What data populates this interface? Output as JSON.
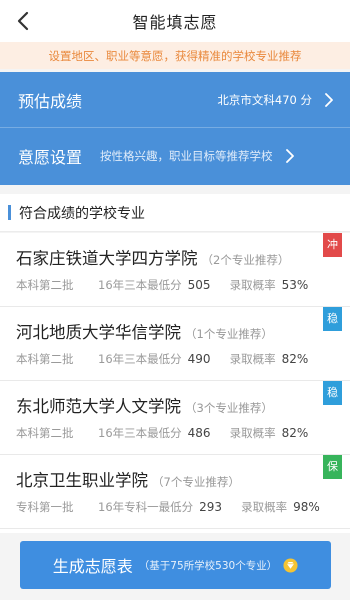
{
  "header": {
    "title": "智能填志愿",
    "back_icon": "back-arrow-icon"
  },
  "tip": {
    "text": "设置地区、职业等意愿，获得精准的学校专业推荐",
    "color": "#e9893d"
  },
  "settings": {
    "score_label": "预估成绩",
    "score_value": "北京市文科470 分",
    "preference_label": "意愿设置",
    "preference_hint": "按性格兴趣，职业目标等推荐学校"
  },
  "section": {
    "title": "符合成绩的学校专业"
  },
  "schools": [
    {
      "name": "石家庄铁道大学四方学院",
      "count": "（2个专业推荐）",
      "batch": "本科第二批",
      "score_label": "16年三本最低分",
      "score": "505",
      "prob_label": "录取概率",
      "prob": "53%",
      "tag": "冲",
      "tag_color": "#e24a4a"
    },
    {
      "name": "河北地质大学华信学院",
      "count": "（1个专业推荐）",
      "batch": "本科第二批",
      "score_label": "16年三本最低分",
      "score": "490",
      "prob_label": "录取概率",
      "prob": "82%",
      "tag": "稳",
      "tag_color": "#2f9edb"
    },
    {
      "name": "东北师范大学人文学院",
      "count": "（3个专业推荐）",
      "batch": "本科第二批",
      "score_label": "16年三本最低分",
      "score": "486",
      "prob_label": "录取概率",
      "prob": "82%",
      "tag": "稳",
      "tag_color": "#2f9edb"
    },
    {
      "name": "北京卫生职业学院",
      "count": "（7个专业推荐）",
      "batch": "专科第一批",
      "score_label": "16年专科一最低分",
      "score": "293",
      "prob_label": "录取概率",
      "prob": "98%",
      "tag": "保",
      "tag_color": "#37b45b"
    }
  ],
  "generate": {
    "label": "生成志愿表",
    "sub": "（基于75所学校530个专业）",
    "icon": "vip-diamond-icon",
    "color": "#3f8ee0"
  },
  "colors": {
    "primary": "#4a90d9",
    "tip_bg": "#fdeee3"
  }
}
